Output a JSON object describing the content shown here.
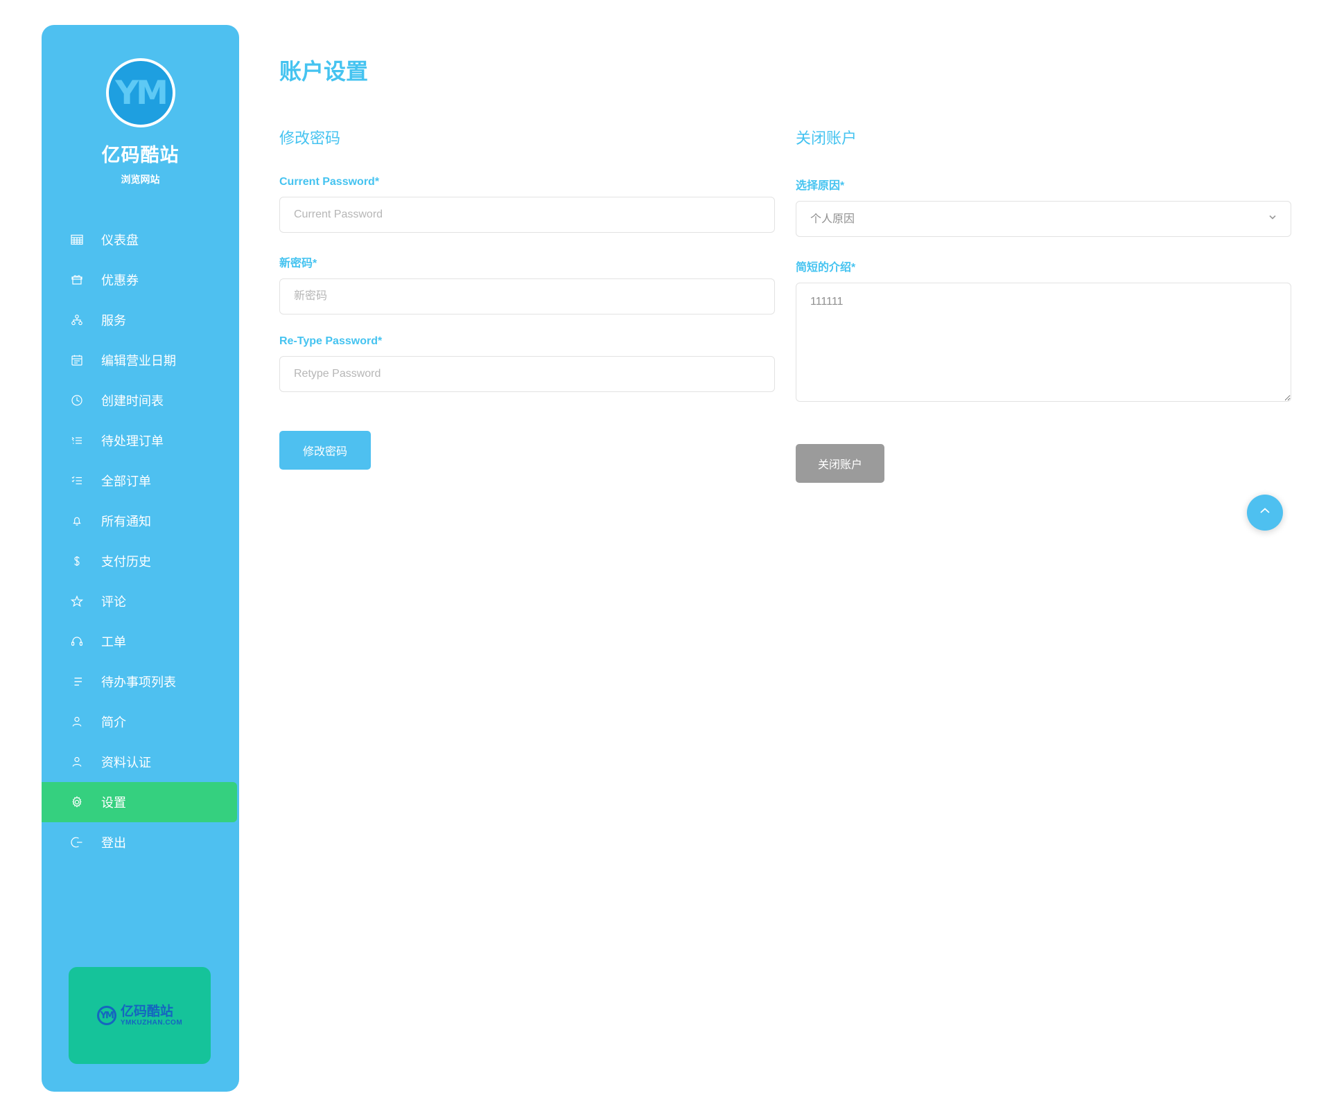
{
  "sidebar": {
    "brand": {
      "logo_icon": "ym-circle-logo",
      "logo_text": "YM",
      "title": "亿码酷站",
      "subtitle": "浏览网站"
    },
    "items": [
      {
        "label": "仪表盘",
        "icon": "grid-dashboard-icon",
        "active": false
      },
      {
        "label": "优惠券",
        "icon": "coupon-icon",
        "active": false
      },
      {
        "label": "服务",
        "icon": "sitemap-icon",
        "active": false
      },
      {
        "label": "编辑营业日期",
        "icon": "calendar-icon",
        "active": false
      },
      {
        "label": "创建时间表",
        "icon": "clock-icon",
        "active": false
      },
      {
        "label": "待处理订单",
        "icon": "list-pending-icon",
        "active": false
      },
      {
        "label": "全部订单",
        "icon": "list-all-icon",
        "active": false
      },
      {
        "label": "所有通知",
        "icon": "bell-icon",
        "active": false
      },
      {
        "label": "支付历史",
        "icon": "dollar-icon",
        "active": false
      },
      {
        "label": "评论",
        "icon": "star-icon",
        "active": false
      },
      {
        "label": "工单",
        "icon": "headset-icon",
        "active": false
      },
      {
        "label": "待办事项列表",
        "icon": "todo-list-icon",
        "active": false
      },
      {
        "label": "简介",
        "icon": "user-icon",
        "active": false
      },
      {
        "label": "资料认证",
        "icon": "user-verify-icon",
        "active": false
      },
      {
        "label": "设置",
        "icon": "gear-icon",
        "active": true
      },
      {
        "label": "登出",
        "icon": "logout-icon",
        "active": false
      }
    ],
    "promo": {
      "mark_text": "YM",
      "title_cn": "亿码酷站",
      "title_en": "YMKUZHAN.COM"
    }
  },
  "main": {
    "page_title": "账户设置",
    "change_password": {
      "section_title": "修改密码",
      "fields": [
        {
          "label": "Current Password*",
          "placeholder": "Current Password",
          "value": ""
        },
        {
          "label": "新密码*",
          "placeholder": "新密码",
          "value": ""
        },
        {
          "label": "Re-Type Password*",
          "placeholder": "Retype Password",
          "value": ""
        }
      ],
      "submit_label": "修改密码"
    },
    "close_account": {
      "section_title": "关闭账户",
      "reason_label": "选择原因*",
      "reason_selected": "个人原因",
      "reason_options": [
        "个人原因"
      ],
      "brief_label": "简短的介绍*",
      "brief_value": "111111",
      "submit_label": "关闭账户"
    }
  },
  "scroll_top": {
    "icon": "chevron-up-icon"
  },
  "colors": {
    "sidebar_bg": "#4ec0f0",
    "accent": "#45c3f0",
    "active_item": "#35d07f",
    "promo_bg": "#15c39a",
    "muted_button": "#9b9b9b"
  }
}
